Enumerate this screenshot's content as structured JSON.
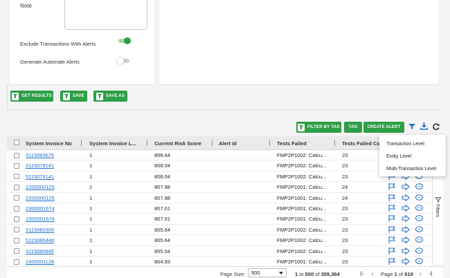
{
  "form": {
    "note_label": "Note",
    "exclude_label": "Exclude Transactions With Alerts",
    "exclude_on": true,
    "generate_label": "Generate Automate Alerts",
    "generate_on": false
  },
  "actions": {
    "get_results": "GET RESULTS",
    "save": "SAVE",
    "save_as": "SAVE AS"
  },
  "toolbar": {
    "filter_by_tag": "FILTER BY TAG",
    "tag": "TAG",
    "create_alert": "CREATE ALERT",
    "icons": [
      "filter-icon",
      "download-icon",
      "refresh-icon"
    ]
  },
  "table": {
    "columns": [
      "System Invoice No",
      "System Invoice L...",
      "Current Risk Score",
      "Alert Id",
      "Tests Failed",
      "Tests Failed Co"
    ],
    "rows": [
      {
        "invoice": "5115083676",
        "line": "1",
        "risk": "808.64",
        "alert": "",
        "tests": "FMP2P1002: Calcu...",
        "count": "23"
      },
      {
        "invoice": "5115076141",
        "line": "1",
        "risk": "808.04",
        "alert": "",
        "tests": "FMP2P1002: Calcu...",
        "count": "23"
      },
      {
        "invoice": "5115076141",
        "line": "1",
        "risk": "808.04",
        "alert": "",
        "tests": "FMP2P1002: Calcu...",
        "count": "23"
      },
      {
        "invoice": "2200000125",
        "line": "1",
        "risk": "807.98",
        "alert": "",
        "tests": "FMP2P1001: Calcu...",
        "count": "24"
      },
      {
        "invoice": "2200000125",
        "line": "1",
        "risk": "807.98",
        "alert": "",
        "tests": "FMP2P1001: Calcu...",
        "count": "24"
      },
      {
        "invoice": "2300001674",
        "line": "1",
        "risk": "807.01",
        "alert": "",
        "tests": "FMP2P1001: Calcu...",
        "count": "23"
      },
      {
        "invoice": "2300001674",
        "line": "1",
        "risk": "807.01",
        "alert": "",
        "tests": "FMP2P1001: Calcu...",
        "count": "23"
      },
      {
        "invoice": "5115080300",
        "line": "1",
        "risk": "805.64",
        "alert": "",
        "tests": "FMP2P1002: Calcu...",
        "count": "23"
      },
      {
        "invoice": "5115086448",
        "line": "1",
        "risk": "805.64",
        "alert": "",
        "tests": "FMP2P1002: Calcu...",
        "count": "23"
      },
      {
        "invoice": "5115080995",
        "line": "1",
        "risk": "805.04",
        "alert": "",
        "tests": "FMP2P1002: Calcu...",
        "count": "23"
      },
      {
        "invoice": "2300001128",
        "line": "1",
        "risk": "804.93",
        "alert": "",
        "tests": "FMP2P1001: Calcu...",
        "count": "23"
      }
    ]
  },
  "menu": {
    "items": [
      "Transaction Level",
      "Entity Level",
      "Multi-Transaction Level"
    ]
  },
  "sidepanel": {
    "filters_label": "Filters"
  },
  "footer": {
    "page_size_label": "Page Size:",
    "page_size_value": "500",
    "range_from": "1",
    "range_to_word": "to",
    "range_to": "500",
    "of_word": "of",
    "total": "309,364",
    "page_word": "Page",
    "page": "1",
    "page_total": "619"
  },
  "colors": {
    "accent_green": "#2e9e47",
    "link_blue": "#1f6fd1",
    "icon_blue": "#1e6fc8"
  }
}
